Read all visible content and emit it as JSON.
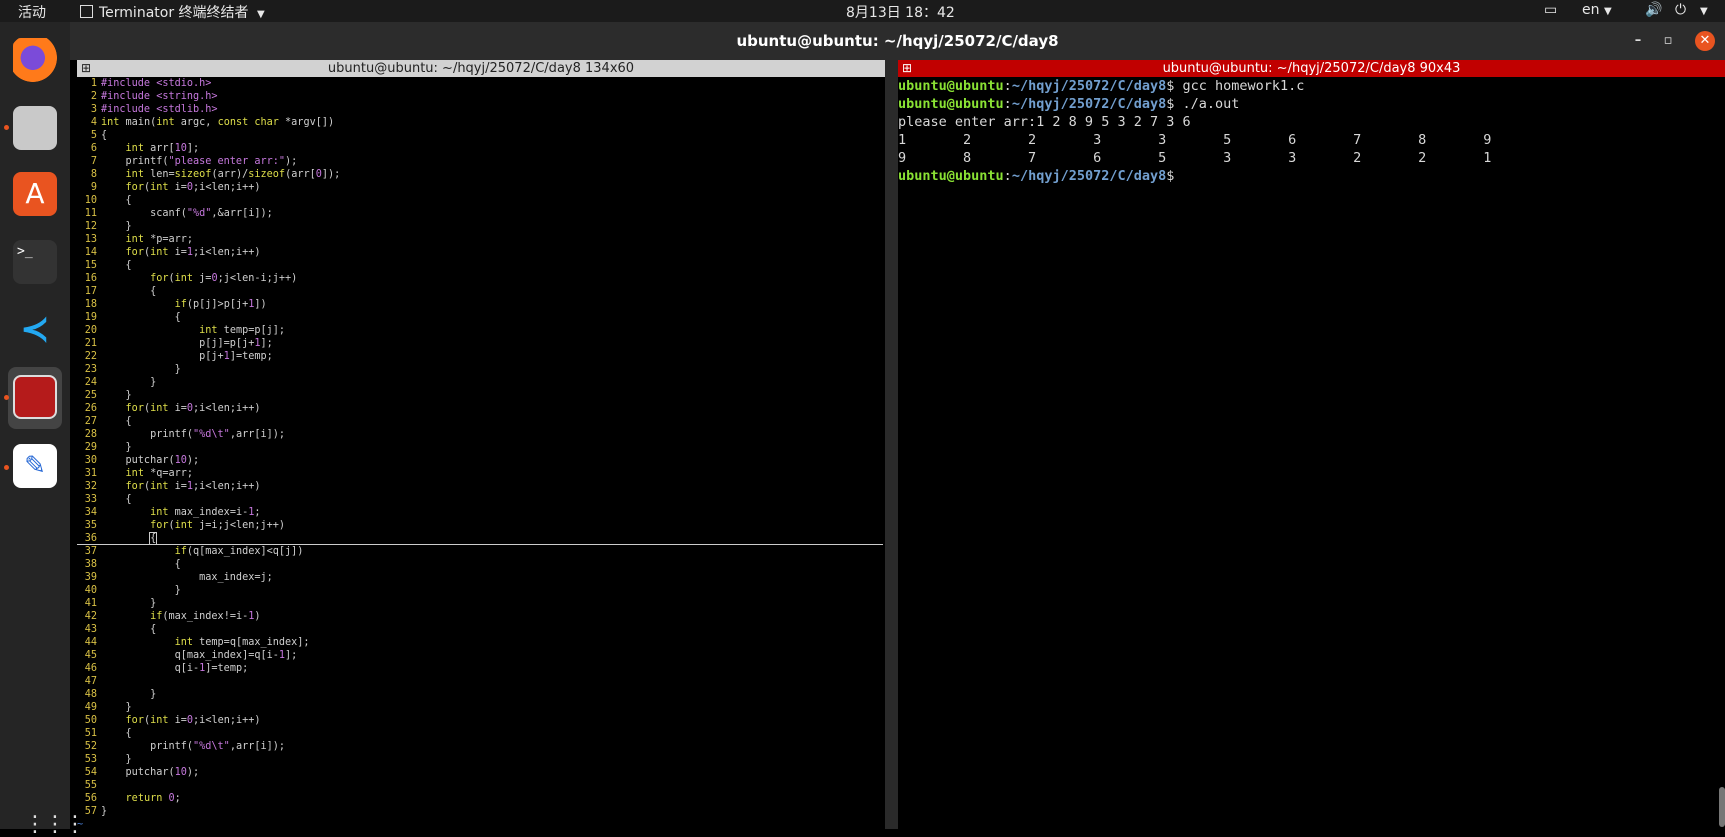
{
  "topbar": {
    "activities": "活动",
    "app_name": "Terminator 终端终结者",
    "clock": "8月13日  18：42",
    "lang": "en"
  },
  "window": {
    "title": "ubuntu@ubuntu: ~/hqyj/25072/C/day8",
    "minimize": "–",
    "maximize": "▫",
    "close": "✕"
  },
  "left_pane": {
    "header": "ubuntu@ubuntu: ~/hqyj/25072/C/day8 134x60",
    "code_lines": [
      {
        "n": "1",
        "html": "<span class='str'>#include</span> <span class='str'>&lt;stdio.h&gt;</span>"
      },
      {
        "n": "2",
        "html": "<span class='str'>#include</span> <span class='str'>&lt;string.h&gt;</span>"
      },
      {
        "n": "3",
        "html": "<span class='str'>#include</span> <span class='str'>&lt;stdlib.h&gt;</span>"
      },
      {
        "n": "4",
        "html": "<span class='kw'>int</span> main(<span class='kw'>int</span> argc, <span class='kw'>const char</span> *argv[])"
      },
      {
        "n": "5",
        "html": "{"
      },
      {
        "n": "6",
        "html": "    <span class='kw'>int</span> arr[<span class='num'>10</span>];"
      },
      {
        "n": "7",
        "html": "    printf(<span class='str'>\"please enter arr:\"</span>);"
      },
      {
        "n": "8",
        "html": "    <span class='kw'>int</span> len=<span class='kw'>sizeof</span>(arr)/<span class='kw'>sizeof</span>(arr[<span class='num'>0</span>]);"
      },
      {
        "n": "9",
        "html": "    <span class='kw'>for</span>(<span class='kw'>int</span> i=<span class='num'>0</span>;i&lt;len;i++)"
      },
      {
        "n": "10",
        "html": "    {"
      },
      {
        "n": "11",
        "html": "        scanf(<span class='str'>\"%d\"</span>,&amp;arr[i]);"
      },
      {
        "n": "12",
        "html": "    }"
      },
      {
        "n": "13",
        "html": "    <span class='kw'>int</span> *p=arr;"
      },
      {
        "n": "14",
        "html": "    <span class='kw'>for</span>(<span class='kw'>int</span> i=<span class='num'>1</span>;i&lt;len;i++)"
      },
      {
        "n": "15",
        "html": "    {"
      },
      {
        "n": "16",
        "html": "        <span class='kw'>for</span>(<span class='kw'>int</span> j=<span class='num'>0</span>;j&lt;len-i;j++)"
      },
      {
        "n": "17",
        "html": "        {"
      },
      {
        "n": "18",
        "html": "            <span class='kw'>if</span>(p[j]&gt;p[j+<span class='num'>1</span>])"
      },
      {
        "n": "19",
        "html": "            {"
      },
      {
        "n": "20",
        "html": "                <span class='kw'>int</span> temp=p[j];"
      },
      {
        "n": "21",
        "html": "                p[j]=p[j+<span class='num'>1</span>];"
      },
      {
        "n": "22",
        "html": "                p[j+<span class='num'>1</span>]=temp;"
      },
      {
        "n": "23",
        "html": "            }"
      },
      {
        "n": "24",
        "html": "        }"
      },
      {
        "n": "25",
        "html": "    }"
      },
      {
        "n": "26",
        "html": "    <span class='kw'>for</span>(<span class='kw'>int</span> i=<span class='num'>0</span>;i&lt;len;i++)"
      },
      {
        "n": "27",
        "html": "    {"
      },
      {
        "n": "28",
        "html": "        printf(<span class='str'>\"%d\\t\"</span>,arr[i]);"
      },
      {
        "n": "29",
        "html": "    }"
      },
      {
        "n": "30",
        "html": "    putchar(<span class='num'>10</span>);"
      },
      {
        "n": "31",
        "html": "    <span class='kw'>int</span> *q=arr;"
      },
      {
        "n": "32",
        "html": "    <span class='kw'>for</span>(<span class='kw'>int</span> i=<span class='num'>1</span>;i&lt;len;i++)"
      },
      {
        "n": "33",
        "html": "    {"
      },
      {
        "n": "34",
        "html": "        <span class='kw'>int</span> max_index=i-<span class='num'>1</span>;"
      },
      {
        "n": "35",
        "html": "        <span class='kw'>for</span>(<span class='kw'>int</span> j=i;j&lt;len;j++)"
      },
      {
        "n": "36",
        "html": "        <span style='outline:1px solid #ccc'>{</span>"
      },
      {
        "n": "37",
        "html": "            <span class='kw'>if</span>(q[max_index]&lt;q[j])"
      },
      {
        "n": "38",
        "html": "            {"
      },
      {
        "n": "39",
        "html": "                max_index=j;"
      },
      {
        "n": "40",
        "html": "            }"
      },
      {
        "n": "41",
        "html": "        }"
      },
      {
        "n": "42",
        "html": "        <span class='kw'>if</span>(max_index!=i-<span class='num'>1</span>)"
      },
      {
        "n": "43",
        "html": "        {"
      },
      {
        "n": "44",
        "html": "            <span class='kw'>int</span> temp=q[max_index];"
      },
      {
        "n": "45",
        "html": "            q[max_index]=q[i-<span class='num'>1</span>];"
      },
      {
        "n": "46",
        "html": "            q[i-<span class='num'>1</span>]=temp;"
      },
      {
        "n": "47",
        "html": ""
      },
      {
        "n": "48",
        "html": "        }"
      },
      {
        "n": "49",
        "html": "    }"
      },
      {
        "n": "50",
        "html": "    <span class='kw'>for</span>(<span class='kw'>int</span> i=<span class='num'>0</span>;i&lt;len;i++)"
      },
      {
        "n": "51",
        "html": "    {"
      },
      {
        "n": "52",
        "html": "        printf(<span class='str'>\"%d\\t\"</span>,arr[i]);"
      },
      {
        "n": "53",
        "html": "    }"
      },
      {
        "n": "54",
        "html": "    putchar(<span class='num'>10</span>);"
      },
      {
        "n": "55",
        "html": ""
      },
      {
        "n": "56",
        "html": "    <span class='kw'>return</span> <span class='num'>0</span>;"
      },
      {
        "n": "57",
        "html": "}"
      }
    ],
    "tilde": "~"
  },
  "right_pane": {
    "header": "ubuntu@ubuntu: ~/hqyj/25072/C/day8 90x43",
    "prompt_user": "ubuntu@ubuntu",
    "prompt_path": "~/hqyj/25072/C/day8",
    "lines": [
      {
        "type": "cmd",
        "text": "$ gcc homework1.c"
      },
      {
        "type": "cmd",
        "text": "$ ./a.out"
      },
      {
        "type": "out",
        "text": "please enter arr:1 2 8 9 5 3 2 7 3 6"
      },
      {
        "type": "out",
        "text": "1       2       2       3       3       5       6       7       8       9"
      },
      {
        "type": "out",
        "text": "9       8       7       6       5       3       3       2       2       1"
      },
      {
        "type": "cmd",
        "text": "$ "
      }
    ]
  }
}
